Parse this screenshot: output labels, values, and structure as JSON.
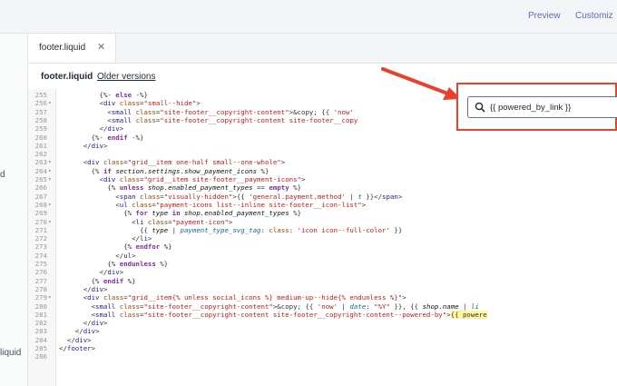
{
  "topbar": {
    "preview": "Preview",
    "customize": "Customiz"
  },
  "sidebar": {
    "items": [
      "d",
      "liquid"
    ]
  },
  "tab": {
    "label": "footer.liquid",
    "close": "✕"
  },
  "file": {
    "name": "footer.liquid",
    "older": "Older versions"
  },
  "search": {
    "value": "{{ powered_by_link }}"
  },
  "code": [
    {
      "n": "255",
      "fold": false,
      "html": "          {%- <span class=\"kw\">else</span> -%}"
    },
    {
      "n": "256",
      "fold": true,
      "html": "          &lt;<span class=\"tag\">div</span> <span class=\"attr\">class</span>=<span class=\"str\">\"small--hide\"</span>&gt;"
    },
    {
      "n": "257",
      "fold": false,
      "html": "            &lt;<span class=\"tag\">small</span> <span class=\"attr\">class</span>=<span class=\"str\">\"site-footer__copyright-content\"</span>&gt;&amp;copy; {{ <span class=\"str\">'now'</span>"
    },
    {
      "n": "258",
      "fold": false,
      "html": "            &lt;<span class=\"tag\">small</span> <span class=\"attr\">class</span>=<span class=\"str\">\"site-footer__copyright-content site-footer__copy</span>"
    },
    {
      "n": "259",
      "fold": false,
      "html": "          &lt;/<span class=\"tag\">div</span>&gt;"
    },
    {
      "n": "260",
      "fold": false,
      "html": "        {%- <span class=\"kw\">endif</span> -%}"
    },
    {
      "n": "261",
      "fold": false,
      "html": "      &lt;/<span class=\"tag\">div</span>&gt;"
    },
    {
      "n": "262",
      "fold": false,
      "html": ""
    },
    {
      "n": "263",
      "fold": true,
      "html": "      &lt;<span class=\"tag\">div</span> <span class=\"attr\">class</span>=<span class=\"str\">\"grid__item one-half small--one-whole\"</span>&gt;"
    },
    {
      "n": "264",
      "fold": true,
      "html": "        {% <span class=\"kw\">if</span> <span class=\"var\">section.settings.show_payment_icons</span> %}"
    },
    {
      "n": "265",
      "fold": true,
      "html": "          &lt;<span class=\"tag\">div</span> <span class=\"attr\">class</span>=<span class=\"str\">\"grid__item site-footer__payment-icons\"</span>&gt;"
    },
    {
      "n": "266",
      "fold": false,
      "html": "            {% <span class=\"kw\">unless</span> <span class=\"var\">shop.enabled_payment_types</span> == <span class=\"kw\">empty</span> %}"
    },
    {
      "n": "267",
      "fold": false,
      "html": "              &lt;<span class=\"tag\">span</span> <span class=\"attr\">class</span>=<span class=\"str\">\"visually-hidden\"</span>&gt;{{ <span class=\"str\">'general.payment.method'</span> | <span class=\"fil\">t</span> }}&lt;/<span class=\"tag\">span</span>&gt;"
    },
    {
      "n": "268",
      "fold": true,
      "html": "              &lt;<span class=\"tag\">ul</span> <span class=\"attr\">class</span>=<span class=\"str\">\"payment-icons list--inline site-footer__icon-list\"</span>&gt;"
    },
    {
      "n": "269",
      "fold": false,
      "html": "                {% <span class=\"kw\">for</span> <span class=\"var\">type</span> <span class=\"kw\">in</span> <span class=\"var\">shop.enabled_payment_types</span> %}"
    },
    {
      "n": "270",
      "fold": true,
      "html": "                  &lt;<span class=\"tag\">li</span> <span class=\"attr\">class</span>=<span class=\"str\">\"payment-icon\"</span>&gt;"
    },
    {
      "n": "271",
      "fold": false,
      "html": "                    {{ <span class=\"var\">type</span> | <span class=\"fil\">payment_type_svg_tag</span>: <span class=\"attr\">class</span>: <span class=\"str\">'icon icon--full-color'</span> }}"
    },
    {
      "n": "272",
      "fold": false,
      "html": "                  &lt;/<span class=\"tag\">li</span>&gt;"
    },
    {
      "n": "273",
      "fold": false,
      "html": "                {% <span class=\"kw\">endfor</span> %}"
    },
    {
      "n": "274",
      "fold": false,
      "html": "              &lt;/<span class=\"tag\">ul</span>&gt;"
    },
    {
      "n": "275",
      "fold": false,
      "html": "            {% <span class=\"kw\">endunless</span> %}"
    },
    {
      "n": "276",
      "fold": false,
      "html": "          &lt;/<span class=\"tag\">div</span>&gt;"
    },
    {
      "n": "277",
      "fold": false,
      "html": "        {% <span class=\"kw\">endif</span> %}"
    },
    {
      "n": "278",
      "fold": false,
      "html": "      &lt;/<span class=\"tag\">div</span>&gt;"
    },
    {
      "n": "279",
      "fold": true,
      "html": "      &lt;<span class=\"tag\">div</span> <span class=\"attr\">class</span>=<span class=\"str\">\"grid__item{% unless social_icons %} medium-up--hide{% endunless %}\"</span>&gt;"
    },
    {
      "n": "280",
      "fold": false,
      "html": "        &lt;<span class=\"tag\">small</span> <span class=\"attr\">class</span>=<span class=\"str\">\"site-footer__copyright-content\"</span>&gt;&amp;copy; {{ <span class=\"str\">'now'</span> | <span class=\"fil\">date</span>: <span class=\"str\">\"%Y\"</span> }}, {{ <span class=\"var\">shop.name</span> | <span class=\"fil\">li</span>"
    },
    {
      "n": "281",
      "fold": false,
      "html": "        &lt;<span class=\"tag\">small</span> <span class=\"attr\">class</span>=<span class=\"str\">\"site-footer__copyright-content site-footer__copyright-content--powered-by\"</span>&gt;<span class=\"hl\">{{ powere</span>"
    },
    {
      "n": "282",
      "fold": false,
      "html": "      &lt;/<span class=\"tag\">div</span>&gt;"
    },
    {
      "n": "283",
      "fold": false,
      "html": "    &lt;/<span class=\"tag\">div</span>&gt;"
    },
    {
      "n": "284",
      "fold": false,
      "html": "  &lt;/<span class=\"tag\">div</span>&gt;"
    },
    {
      "n": "285",
      "fold": false,
      "html": "&lt;/<span class=\"tag\">footer</span>&gt;"
    },
    {
      "n": "286",
      "fold": false,
      "html": ""
    }
  ]
}
